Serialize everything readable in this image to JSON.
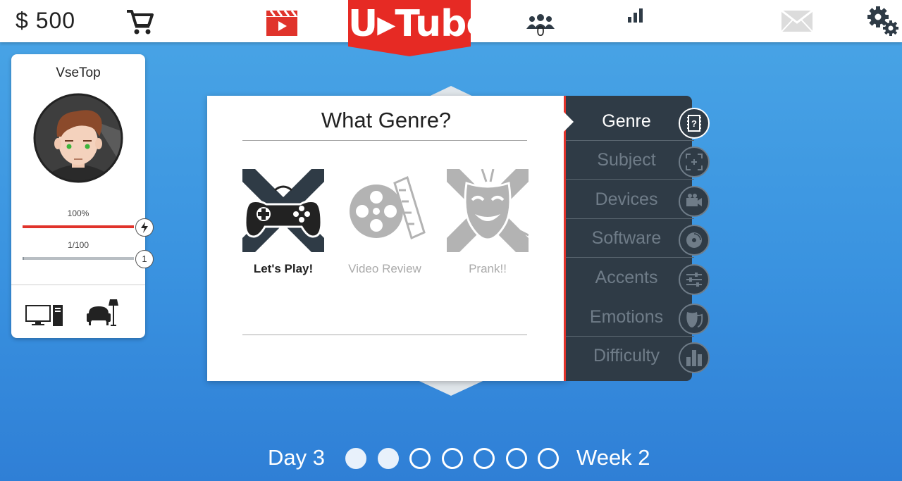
{
  "topbar": {
    "money": "$ 500",
    "logo": "U▸Tube",
    "subscribers_count": "0",
    "icons": [
      "cart-icon",
      "clapper-icon",
      "subscribers-icon",
      "stats-icon",
      "mail-icon",
      "settings-icon"
    ]
  },
  "profile": {
    "name": "VseTop",
    "energy_label": "100%",
    "energy_fraction": 1.0,
    "xp_label": "1/100",
    "xp_fraction": 0.01,
    "level": "1",
    "energy_color": "#e0332b"
  },
  "panel": {
    "title": "What Genre?",
    "genres": [
      {
        "label": "Let's Play!",
        "state": "active"
      },
      {
        "label": "Video Review",
        "state": "dim"
      },
      {
        "label": "Prank!!",
        "state": "dim"
      }
    ]
  },
  "tabs": [
    {
      "label": "Genre",
      "icon": "film-question-icon",
      "active": true
    },
    {
      "label": "Subject",
      "icon": "target-icon",
      "active": false
    },
    {
      "label": "Devices",
      "icon": "camera-icon",
      "active": false
    },
    {
      "label": "Software",
      "icon": "disc-icon",
      "active": false
    },
    {
      "label": "Accents",
      "icon": "sliders-icon",
      "active": false
    },
    {
      "label": "Emotions",
      "icon": "masks-icon",
      "active": false
    },
    {
      "label": "Difficulty",
      "icon": "bars-icon",
      "active": false
    }
  ],
  "footer": {
    "day": "Day 3",
    "week": "Week 2",
    "days_in_week": 7,
    "days_elapsed": 2
  },
  "colors": {
    "accent": "#e0332b",
    "panel_dark": "#2f3b46",
    "background": "#3a93e0"
  }
}
